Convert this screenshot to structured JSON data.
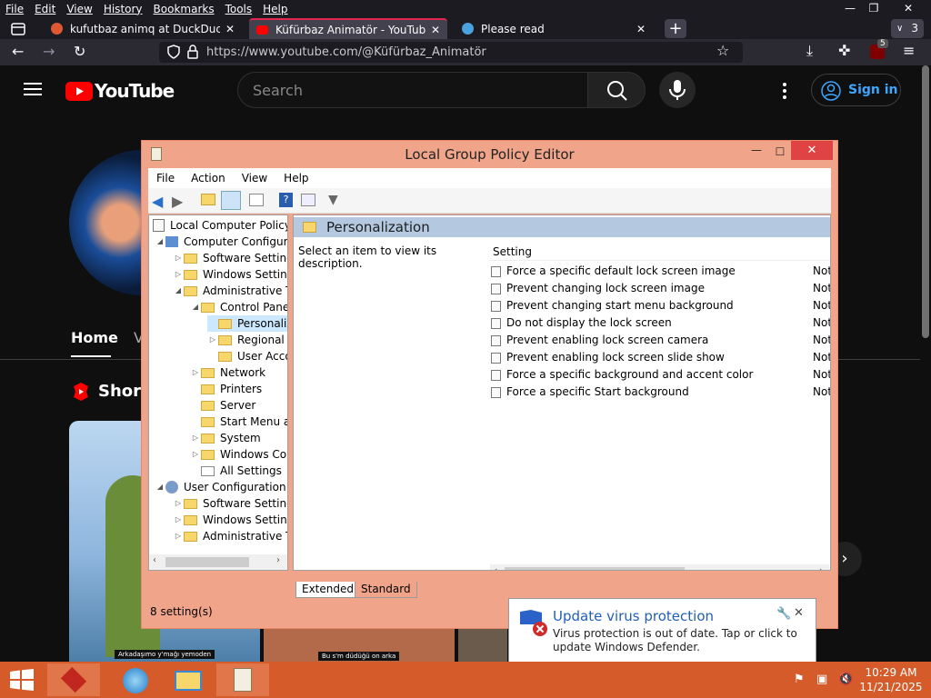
{
  "firefox": {
    "menu": [
      "File",
      "Edit",
      "View",
      "History",
      "Bookmarks",
      "Tools",
      "Help"
    ],
    "tabs": [
      {
        "title": "kufutbaz animq at DuckDuckGo",
        "close": "✕"
      },
      {
        "title": "Küfürbaz Animatör - YouTube",
        "close": "✕"
      },
      {
        "title": "Please read",
        "close": "✕"
      }
    ],
    "new_tab": "+",
    "tab_count": "3",
    "url": "https://www.youtube.com/@Küfürbaz_Animatör",
    "ext_badge": "5",
    "window_controls": {
      "min": "—",
      "restore": "❐",
      "close": "✕"
    }
  },
  "youtube": {
    "logo": "YouTube",
    "search_placeholder": "Search",
    "sign_in": "Sign in",
    "tab_home": "Home",
    "tab_next": "V",
    "shorts_title": "Short",
    "thumb_caption_1": "Arkadaşımo y'mağı yemoden",
    "thumb_caption_2": "Bu s'm düdüğü on arka"
  },
  "gpe": {
    "title": "Local Group Policy Editor",
    "menu": [
      "File",
      "Action",
      "View",
      "Help"
    ],
    "tree": [
      "Local Computer Policy",
      "Computer Configura",
      "Software Settings",
      "Windows Setting",
      "Administrative Te",
      "Control Panel",
      "Personaliz",
      "Regional a",
      "User Acco",
      "Network",
      "Printers",
      "Server",
      "Start Menu ar",
      "System",
      "Windows Cor",
      "All Settings",
      "User Configuration",
      "Software Settings",
      "Windows Setting",
      "Administrative Te"
    ],
    "pane_title": "Personalization",
    "description": "Select an item to view its description.",
    "col_setting": "Setting",
    "settings": [
      {
        "name": "Force a specific default lock screen image",
        "state": "Not"
      },
      {
        "name": "Prevent changing lock screen image",
        "state": "Not"
      },
      {
        "name": "Prevent changing start menu background",
        "state": "Not"
      },
      {
        "name": "Do not display the lock screen",
        "state": "Not"
      },
      {
        "name": "Prevent enabling lock screen camera",
        "state": "Not"
      },
      {
        "name": "Prevent enabling lock screen slide show",
        "state": "Not"
      },
      {
        "name": "Force a specific background and accent color",
        "state": "Not"
      },
      {
        "name": "Force a specific Start background",
        "state": "Not"
      }
    ],
    "tab_extended": "Extended",
    "tab_standard": "Standard",
    "status": "8 setting(s)"
  },
  "notification": {
    "title": "Update virus protection",
    "body": "Virus protection is out of date. Tap or click to update Windows Defender."
  },
  "taskbar": {
    "time": "10:29 AM",
    "date": "11/21/2025"
  }
}
